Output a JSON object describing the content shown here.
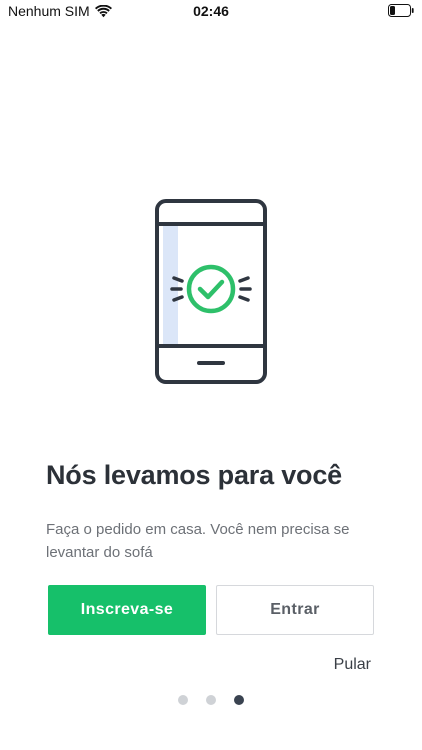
{
  "status_bar": {
    "carrier": "Nenhum SIM",
    "time": "02:46",
    "icons": [
      "wifi-icon",
      "battery-icon"
    ]
  },
  "onboarding": {
    "illustration_icon": "phone-check-icon",
    "title": "Nós levamos para você",
    "description": "Faça o pedido em casa. Você nem precisa se levantar do sofá",
    "signup_label": "Inscreva-se",
    "login_label": "Entrar",
    "skip_label": "Pular",
    "page_count": 3,
    "active_page": 3
  },
  "colors": {
    "primary": "#16c06a",
    "text_dark": "#2c3138",
    "text_muted": "#6d7177",
    "dot_inactive": "#cfd2d6",
    "dot_active": "#3a4350"
  }
}
